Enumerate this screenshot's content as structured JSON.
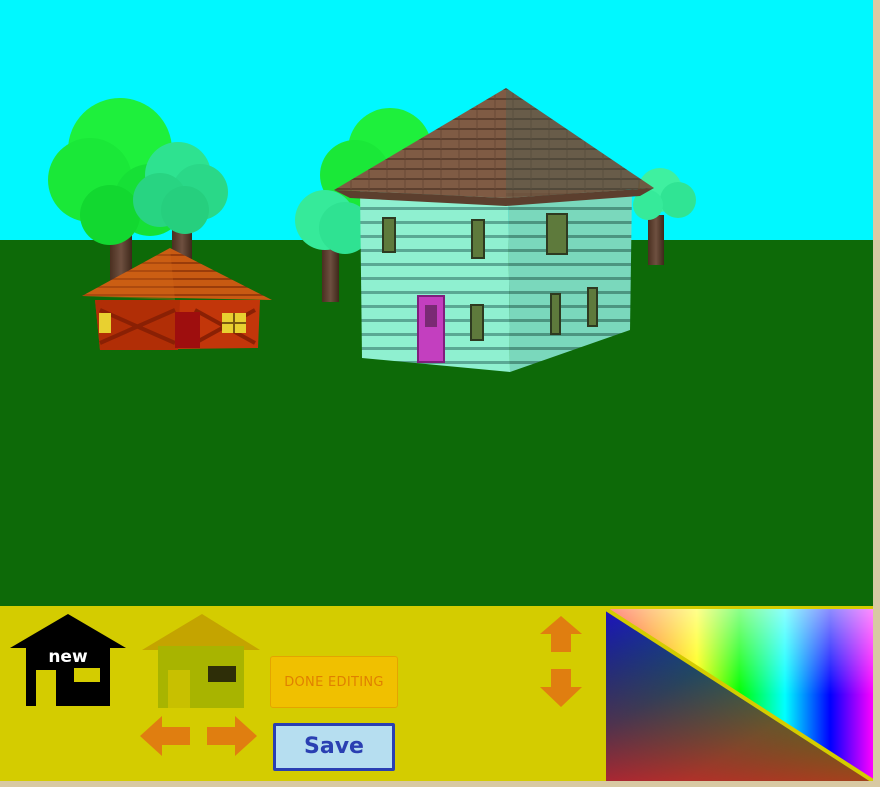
{
  "scene": {
    "sky_color": "#00f8ff",
    "ground_color": "#0d6a08",
    "objects": [
      "tree",
      "tree",
      "tree",
      "tree",
      "tree",
      "small-house",
      "two-story-house"
    ]
  },
  "toolbar": {
    "background_color": "#d4cc00",
    "new_house_label": "new",
    "done_editing_label": "DONE EDITING",
    "save_label": "Save",
    "icons": [
      "new-house-icon",
      "edit-house-icon",
      "rotate-left-arrow-icon",
      "rotate-right-arrow-icon",
      "move-up-arrow-icon",
      "move-down-arrow-icon"
    ]
  },
  "color_picker": {
    "name": "color-picker",
    "type": "gradient-triangle"
  }
}
